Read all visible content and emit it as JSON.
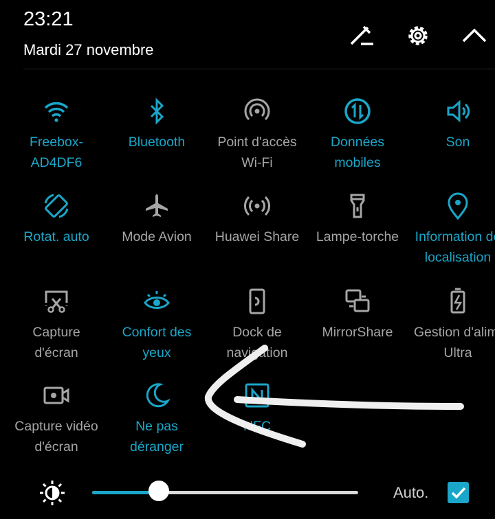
{
  "header": {
    "time": "23:21",
    "date": "Mardi 27 novembre",
    "edit_icon": "pencil-icon",
    "settings_icon": "gear-icon",
    "collapse_icon": "chevron-up-icon"
  },
  "colors": {
    "accent": "#1aa6c8",
    "inactive": "#a6a6a6",
    "background": "#000000"
  },
  "tiles": [
    {
      "label": "Freebox-\nAD4DF6",
      "icon": "wifi-icon",
      "active": true
    },
    {
      "label": "Bluetooth",
      "icon": "bluetooth-icon",
      "active": true
    },
    {
      "label": "Point d'accès\nWi-Fi",
      "icon": "hotspot-icon",
      "active": false
    },
    {
      "label": "Données\nmobiles",
      "icon": "mobile-data-icon",
      "active": true
    },
    {
      "label": "Son",
      "icon": "speaker-icon",
      "active": true
    },
    {
      "label": "Rotat. auto",
      "icon": "auto-rotate-icon",
      "active": true
    },
    {
      "label": "Mode Avion",
      "icon": "airplane-icon",
      "active": false
    },
    {
      "label": "Huawei Share",
      "icon": "huawei-share-icon",
      "active": false
    },
    {
      "label": "Lampe-torche",
      "icon": "flashlight-icon",
      "active": false
    },
    {
      "label": "Information de\nlocalisation",
      "icon": "location-icon",
      "active": true
    },
    {
      "label": "Capture\nd'écran",
      "icon": "screenshot-icon",
      "active": false
    },
    {
      "label": "Confort des\nyeux",
      "icon": "eye-icon",
      "active": true
    },
    {
      "label": "Dock de\nnavigation",
      "icon": "nav-dock-icon",
      "active": false
    },
    {
      "label": "MirrorShare",
      "icon": "mirrorshare-icon",
      "active": false
    },
    {
      "label": "Gestion d'alim.\nUltra",
      "icon": "battery-icon",
      "active": false
    },
    {
      "label": "Capture vidéo\nd'écran",
      "icon": "screen-record-icon",
      "active": false
    },
    {
      "label": "Ne pas\ndéranger",
      "icon": "moon-icon",
      "active": true
    },
    {
      "label": "NFC",
      "icon": "nfc-icon",
      "active": true
    }
  ],
  "brightness": {
    "icon": "brightness-icon",
    "level": 0.25,
    "auto_label": "Auto.",
    "auto_checked": true
  }
}
